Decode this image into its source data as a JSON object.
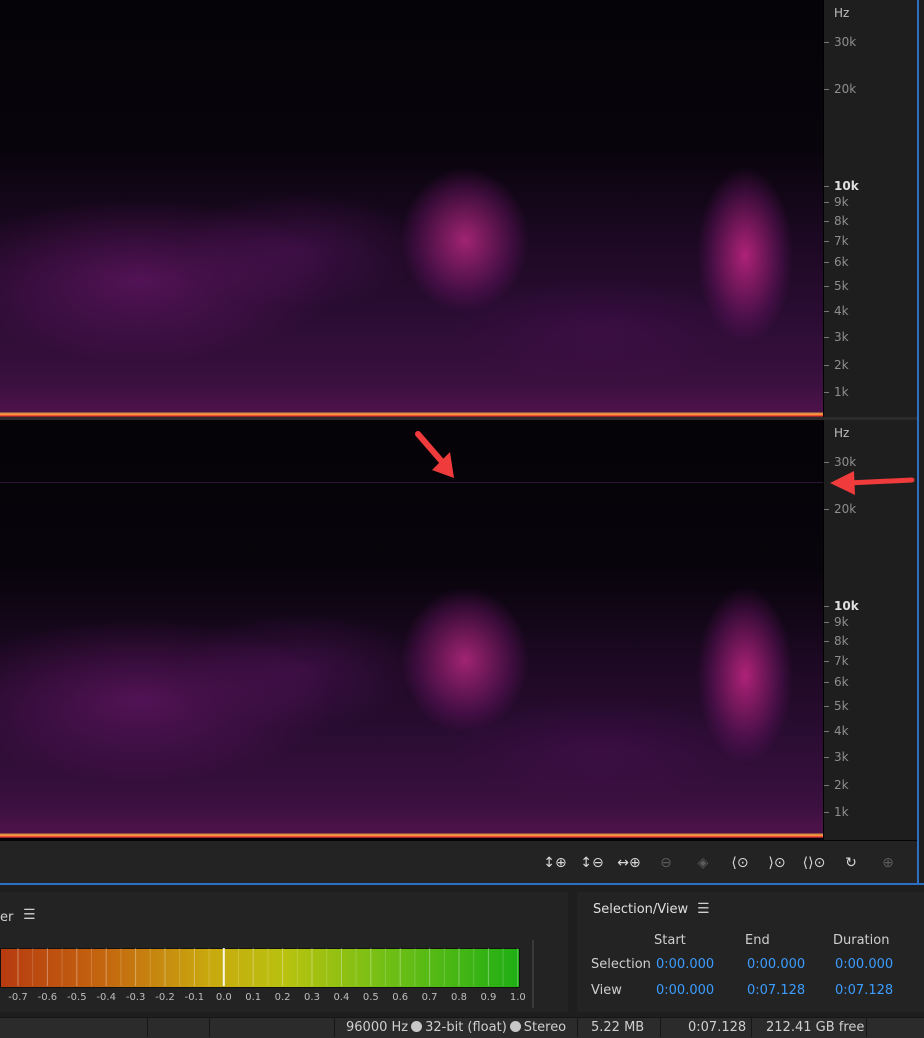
{
  "spectrogram": {
    "unit": "Hz",
    "top_labels": [
      {
        "text": "30k",
        "major": false
      },
      {
        "text": "20k",
        "major": false
      },
      {
        "text": "10k",
        "major": true
      },
      {
        "text": "9k",
        "major": false
      },
      {
        "text": "8k",
        "major": false
      },
      {
        "text": "7k",
        "major": false
      },
      {
        "text": "6k",
        "major": false
      },
      {
        "text": "5k",
        "major": false
      },
      {
        "text": "4k",
        "major": false
      },
      {
        "text": "3k",
        "major": false
      },
      {
        "text": "2k",
        "major": false
      },
      {
        "text": "1k",
        "major": false
      }
    ],
    "bottom_labels": [
      {
        "text": "30k",
        "major": false
      },
      {
        "text": "20k",
        "major": false
      },
      {
        "text": "10k",
        "major": true
      },
      {
        "text": "9k",
        "major": false
      },
      {
        "text": "8k",
        "major": false
      },
      {
        "text": "7k",
        "major": false
      },
      {
        "text": "6k",
        "major": false
      },
      {
        "text": "5k",
        "major": false
      },
      {
        "text": "4k",
        "major": false
      },
      {
        "text": "3k",
        "major": false
      },
      {
        "text": "2k",
        "major": false
      },
      {
        "text": "1k",
        "major": false
      }
    ]
  },
  "zoom_toolbar": [
    {
      "icon": "zoom-in-amplitude-icon",
      "glyph": "↕⊕",
      "enabled": true
    },
    {
      "icon": "zoom-out-amplitude-icon",
      "glyph": "↕⊖",
      "enabled": true
    },
    {
      "icon": "zoom-in-time-icon",
      "glyph": "↔⊕",
      "enabled": true
    },
    {
      "icon": "zoom-out-full-icon",
      "glyph": "⊖",
      "enabled": false
    },
    {
      "icon": "zoom-selection-icon",
      "glyph": "◈",
      "enabled": false
    },
    {
      "icon": "zoom-in-point-icon",
      "glyph": "⟨⊙",
      "enabled": true
    },
    {
      "icon": "zoom-out-point-icon",
      "glyph": "⟩⊙",
      "enabled": true
    },
    {
      "icon": "zoom-all-icon",
      "glyph": "⟨⟩⊙",
      "enabled": true
    },
    {
      "icon": "zoom-reset-icon",
      "glyph": "↻",
      "enabled": true
    },
    {
      "icon": "zoom-to-selection-icon",
      "glyph": "⊕",
      "enabled": false
    }
  ],
  "levels": {
    "title_fragment": "er",
    "scale": [
      "-0.7",
      "-0.6",
      "-0.5",
      "-0.4",
      "-0.3",
      "-0.2",
      "-0.1",
      "0.0",
      "0.1",
      "0.2",
      "0.3",
      "0.4",
      "0.5",
      "0.6",
      "0.7",
      "0.8",
      "0.9",
      "1.0"
    ]
  },
  "selection_view": {
    "title": "Selection/View",
    "headers": {
      "start": "Start",
      "end": "End",
      "duration": "Duration"
    },
    "rows": [
      {
        "label": "Selection",
        "start": "0:00.000",
        "end": "0:00.000",
        "duration": "0:00.000"
      },
      {
        "label": "View",
        "start": "0:00.000",
        "end": "0:07.128",
        "duration": "0:07.128"
      }
    ]
  },
  "status": {
    "sample_rate": "96000 Hz",
    "bit_depth": "32-bit (float)",
    "channels": "Stereo",
    "file_size": "5.22 MB",
    "duration": "0:07.128",
    "free_space": "212.41 GB free"
  },
  "colors": {
    "accent": "#2d6fc2",
    "value_blue": "#3b9dff",
    "annotation": "#ef3b3b"
  }
}
